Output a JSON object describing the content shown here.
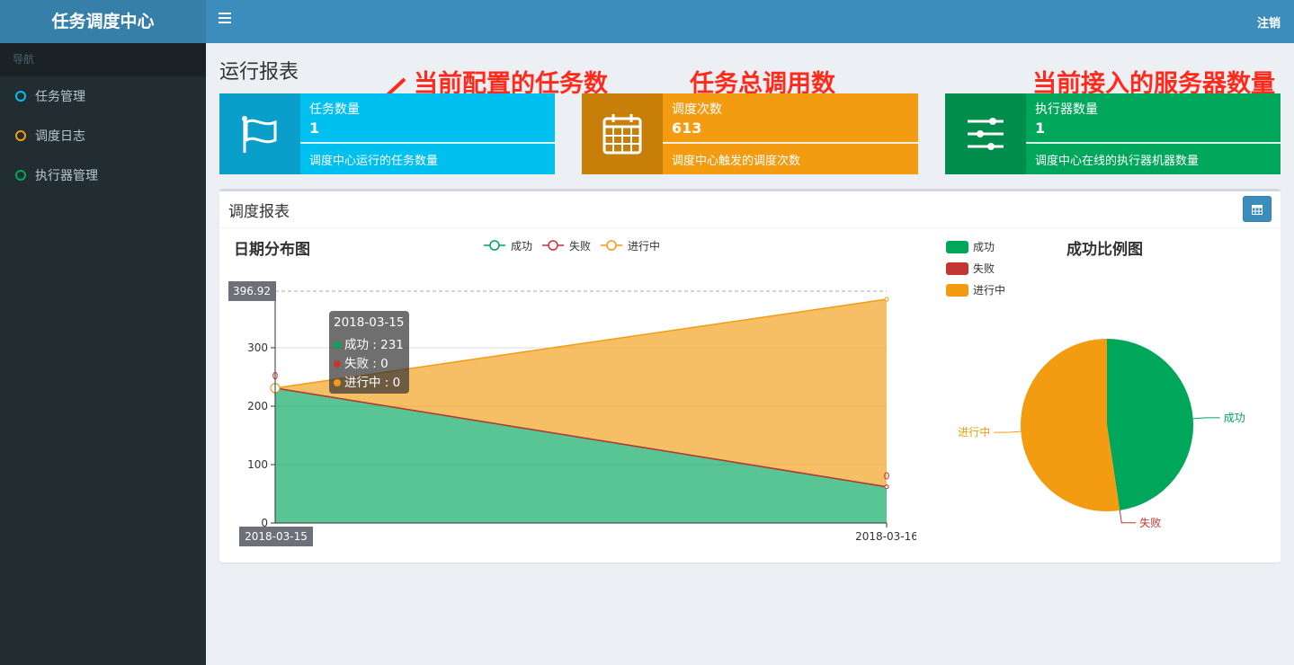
{
  "app_title": "任务调度中心",
  "nav": {
    "header": "导航",
    "items": [
      {
        "label": "任务管理",
        "color": "#00c0ef"
      },
      {
        "label": "调度日志",
        "color": "#f39c12"
      },
      {
        "label": "执行器管理",
        "color": "#00a65a"
      }
    ]
  },
  "topbar": {
    "logout": "注销"
  },
  "page_title": "运行报表",
  "annotations": [
    "当前配置的任务数",
    "任务总调用数",
    "当前接入的服务器数量"
  ],
  "info_boxes": [
    {
      "label": "任务数量",
      "value": "1",
      "desc": "调度中心运行的任务数量",
      "icon": "flag-icon",
      "color": "#00c0ef",
      "icon_bg": "#0a9fca"
    },
    {
      "label": "调度次数",
      "value": "613",
      "desc": "调度中心触发的调度次数",
      "icon": "calendar-icon",
      "color": "#f39c12",
      "icon_bg": "#c87f0a"
    },
    {
      "label": "执行器数量",
      "value": "1",
      "desc": "调度中心在线的执行器机器数量",
      "icon": "sliders-icon",
      "color": "#00a65a",
      "icon_bg": "#008d4c"
    }
  ],
  "report": {
    "title": "调度报表"
  },
  "chart_data": [
    {
      "type": "area",
      "title": "日期分布图",
      "x": [
        "2018-03-15",
        "2018-03-16"
      ],
      "series": [
        {
          "name": "成功",
          "values": [
            231,
            62
          ],
          "color": "#00a65a"
        },
        {
          "name": "失败",
          "values": [
            0,
            0
          ],
          "color": "#c23531"
        },
        {
          "name": "进行中",
          "values": [
            0,
            321
          ],
          "color": "#f39c12"
        }
      ],
      "stacked": true,
      "ylim": [
        0,
        396.92
      ],
      "yticks": [
        0,
        100,
        200,
        300
      ],
      "max_marker": "396.92",
      "legend_placement": "top-center",
      "data_labels": [
        "0",
        "0"
      ],
      "tooltip": {
        "date": "2018-03-15",
        "lines": [
          "成功 : 231",
          "失败 : 0",
          "进行中 : 0"
        ]
      },
      "axis_pointer_label": "2018-03-15",
      "x_tick_labels": [
        "2018-03-15",
        "2018-03-16"
      ]
    },
    {
      "type": "pie",
      "title": "成功比例图",
      "categories": [
        "成功",
        "失败",
        "进行中"
      ],
      "values": [
        292,
        0,
        321
      ],
      "colors": [
        "#00a65a",
        "#c23531",
        "#f39c12"
      ],
      "legend_placement": "top-left"
    }
  ]
}
